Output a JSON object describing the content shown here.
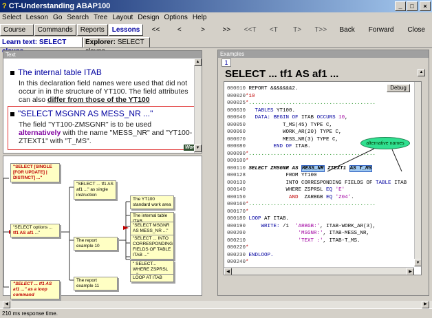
{
  "window": {
    "title": "CT-Understanding ABAP100",
    "controls": [
      "_",
      "□",
      "×"
    ]
  },
  "menu": [
    "Select",
    "Lesson",
    "Go",
    "Search",
    "Tree",
    "Layout",
    "Design",
    "Options",
    "Help"
  ],
  "toolbar": {
    "tabs": [
      "Course 3",
      "Commands",
      "Reports",
      "Lessons"
    ],
    "active_tab": "Lessons",
    "nav": [
      "<<",
      "<",
      ">",
      ">>",
      "<<T",
      "<T",
      "T>",
      "T>>"
    ],
    "buttons": [
      "Back",
      "Forward",
      "Close"
    ]
  },
  "subtabs": {
    "learn_text": "Learn text: SELECT clause",
    "explorer_label": "Explorer:",
    "explorer_value": "SELECT clause"
  },
  "text_panel": {
    "header": "Text",
    "section1": {
      "title": "The internal table ITAB",
      "body": "In this declaration field names were used that did not occur in in the structure of YT100. The field attributes can also ",
      "link": "differ from those of the YT100"
    },
    "section2": {
      "title": "\"SELECT MSGNR AS MESS_NR ...\"",
      "body1": "The field \"YT100-ZMSGNR\" is to be used ",
      "alt": "alternatively",
      "body2": " with the name \"MESS_NR\" and \"YT100-ZTEXT1\" with \"T_MS\".",
      "badge": "Work"
    }
  },
  "tree": {
    "nodes": {
      "root1": "\"SELECT [SINGLE [FOR UPDATE] | DISTINCT] ...\"",
      "root2a": "\"SELECT options ... ",
      "root2b": "tf1 AS af1",
      "root2c": " ...\"",
      "root3": "\"SELECT ... tf1 AS af1 ...\" as a loop command",
      "mid1": "\"SELECT ... tf1 AS af1 ...\" as single instruction",
      "mid2": "The report example 10",
      "mid3": "The report example 11",
      "leaf1": "The YT100 standard work area",
      "leaf2": "The internal table ITAB",
      "leaf3": "\"SELECT MSGNR AS MESS_NR ...\"",
      "leaf4": "\"SELECT ... INTO CORRESPONDING FIELDS OF TABLE ITAB ...\"",
      "leaf5": "\" SELECT... WHERE ZSPRSL ...\"",
      "leaf6": "LOOP AT ITAB"
    }
  },
  "examples": {
    "header": "Examples",
    "tab": "1",
    "title": "SELECT ... tf1 AS af1 ...",
    "debug_button": "Debug",
    "callout": "alternative names",
    "code": [
      {
        "ln": "000010",
        "parts": [
          [
            "",
            " REPORT &&&&&&&2."
          ]
        ]
      },
      {
        "ln": "000020",
        "parts": [
          [
            "cm",
            "*10"
          ]
        ]
      },
      {
        "ln": "000025",
        "parts": [
          [
            "cm",
            "*"
          ],
          [
            "dots",
            "........................................."
          ]
        ]
      },
      {
        "ln": "000030",
        "parts": [
          [
            "",
            "   "
          ],
          [
            "kw",
            "TABLES"
          ],
          [
            "",
            " YT100."
          ]
        ]
      },
      {
        "ln": "000040",
        "parts": [
          [
            "",
            "   "
          ],
          [
            "kw",
            "DATA: BEGIN OF"
          ],
          [
            "",
            " ITAB "
          ],
          [
            "kw",
            "OCCURS"
          ],
          [
            "",
            " "
          ],
          [
            "lit",
            "10"
          ],
          [
            "",
            ","
          ]
        ]
      },
      {
        "ln": "000050",
        "parts": [
          [
            "",
            "            T_MS(45) TYPE C,"
          ]
        ]
      },
      {
        "ln": "000060",
        "parts": [
          [
            "",
            "            WORK_AR(20) TYPE C,"
          ]
        ]
      },
      {
        "ln": "000070",
        "parts": [
          [
            "",
            "            MESS_NR(3) TYPE C,"
          ]
        ]
      },
      {
        "ln": "000080",
        "parts": [
          [
            "",
            "         "
          ],
          [
            "kw",
            "END OF"
          ],
          [
            "",
            " ITAB."
          ]
        ]
      },
      {
        "ln": "000090",
        "parts": [
          [
            "cm",
            "*"
          ],
          [
            "dots",
            "........................................."
          ]
        ]
      },
      {
        "ln": "000100",
        "parts": [
          [
            "cm",
            "*"
          ]
        ]
      },
      {
        "ln": "000110",
        "parts": [
          [
            "",
            " "
          ],
          [
            "b",
            "SELECT ZMSGNR AS "
          ],
          [
            "hl",
            "MESS_NR"
          ],
          [
            "b",
            " ZTEXT1 "
          ],
          [
            "hl",
            "AS T_MS"
          ]
        ]
      },
      {
        "ln": "000128",
        "parts": [
          [
            "",
            "             FROM YT100"
          ]
        ]
      },
      {
        "ln": "000130",
        "parts": [
          [
            "",
            "             INTO CORRESPONDING FIELDS OF "
          ],
          [
            "kw",
            "TABLE"
          ],
          [
            "",
            " ITAB"
          ]
        ]
      },
      {
        "ln": "000140",
        "parts": [
          [
            "",
            "             WHERE ZSPRSL "
          ],
          [
            "kw",
            "EQ"
          ],
          [
            "",
            " "
          ],
          [
            "lit",
            "'E'"
          ]
        ]
      },
      {
        "ln": "000150",
        "parts": [
          [
            "",
            "              "
          ],
          [
            "cm",
            "AND"
          ],
          [
            "",
            "  ZARBGB "
          ],
          [
            "kw",
            "EQ"
          ],
          [
            "",
            " "
          ],
          [
            "lit",
            "'Z04'"
          ],
          [
            "",
            "."
          ]
        ]
      },
      {
        "ln": "000160",
        "parts": [
          [
            "cm",
            "*"
          ],
          [
            "dots",
            "........................................."
          ]
        ]
      },
      {
        "ln": "000170",
        "parts": [
          [
            "cm",
            "*"
          ]
        ]
      },
      {
        "ln": "000180",
        "parts": [
          [
            "",
            " "
          ],
          [
            "kw",
            "LOOP"
          ],
          [
            "",
            " AT ITAB."
          ]
        ]
      },
      {
        "ln": "000190",
        "parts": [
          [
            "",
            "     "
          ],
          [
            "kw",
            "WRITE:"
          ],
          [
            "",
            " /1  "
          ],
          [
            "lit",
            "'ARBGB:'"
          ],
          [
            "",
            ", ITAB-WORK_AR(3),"
          ]
        ]
      },
      {
        "ln": "000200",
        "parts": [
          [
            "",
            "                 "
          ],
          [
            "lit",
            "'MSGNR:'"
          ],
          [
            "",
            ", ITAB-MESS_NR,"
          ]
        ]
      },
      {
        "ln": "000210",
        "parts": [
          [
            "",
            "                 "
          ],
          [
            "lit",
            "'TEXT :'"
          ],
          [
            "",
            ", ITAB-T_MS."
          ]
        ]
      },
      {
        "ln": "000220",
        "parts": [
          [
            "cm",
            "*"
          ]
        ]
      },
      {
        "ln": "000230",
        "parts": [
          [
            "",
            " "
          ],
          [
            "kw",
            "ENDLOOP."
          ]
        ]
      },
      {
        "ln": "000240",
        "parts": [
          [
            "cm",
            "*"
          ]
        ]
      }
    ]
  },
  "status": "210 ms response time."
}
